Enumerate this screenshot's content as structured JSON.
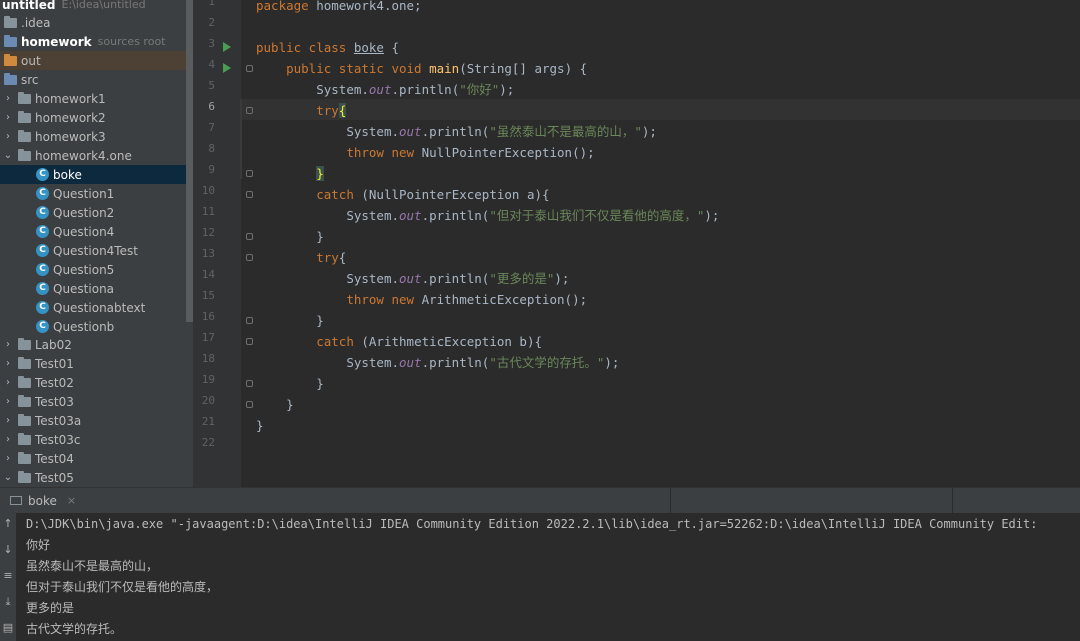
{
  "project": {
    "root": {
      "name": "untitled",
      "path": "E:\\idea\\untitled"
    },
    "items": [
      {
        "label": "idea_row",
        "text": ".idea",
        "depth": 0
      },
      {
        "label": "homework",
        "text": "homework",
        "hint": "sources root"
      },
      {
        "label": "out",
        "text": "out"
      },
      {
        "label": "src",
        "text": "src"
      },
      {
        "label": "homework1",
        "text": "homework1"
      },
      {
        "label": "homework2",
        "text": "homework2"
      },
      {
        "label": "homework3",
        "text": "homework3"
      },
      {
        "label": "homework4",
        "text": "homework4.one"
      },
      {
        "label": "boke",
        "text": "boke"
      },
      {
        "label": "q1",
        "text": "Question1"
      },
      {
        "label": "q2",
        "text": "Question2"
      },
      {
        "label": "q4",
        "text": "Question4"
      },
      {
        "label": "q4t",
        "text": "Question4Test"
      },
      {
        "label": "q5",
        "text": "Question5"
      },
      {
        "label": "qa",
        "text": "Questiona"
      },
      {
        "label": "qab",
        "text": "Questionabtext"
      },
      {
        "label": "qb",
        "text": "Questionb"
      },
      {
        "label": "lab02",
        "text": "Lab02"
      },
      {
        "label": "t01",
        "text": "Test01"
      },
      {
        "label": "t02",
        "text": "Test02"
      },
      {
        "label": "t03",
        "text": "Test03"
      },
      {
        "label": "t03a",
        "text": "Test03a"
      },
      {
        "label": "t03c",
        "text": "Test03c"
      },
      {
        "label": "t04",
        "text": "Test04"
      },
      {
        "label": "t05",
        "text": "Test05"
      }
    ]
  },
  "editor": {
    "line_numbers": [
      "1",
      "2",
      "3",
      "4",
      "5",
      "6",
      "7",
      "8",
      "9",
      "10",
      "11",
      "12",
      "13",
      "14",
      "15",
      "16",
      "17",
      "18",
      "19",
      "20",
      "21",
      "22"
    ],
    "code": {
      "l1_kw": "package",
      "l1_rest": " homework4.one;",
      "l3_kw": "public class",
      "l3_cls": "boke",
      "l3_rest": " {",
      "l4_kw": "public static void",
      "l4_fn": "main",
      "l4_rest": "(String[] args) {",
      "sys": "System.",
      "out": "out",
      "println": ".println(",
      "l5_str": "\"你好\"",
      "end": ");",
      "try": "try",
      "brace_open": "{",
      "brace_close": "}",
      "l7_str": "\"虽然泰山不是最高的山，\"",
      "throw_new": "throw new",
      "l8_rest": " NullPointerException();",
      "catch": "catch",
      "l10_rest": " (NullPointerException a){",
      "l11_str": "\"但对于泰山我们不仅是看他的高度，\"",
      "l14_str": "\"更多的是\"",
      "l15_rest": " ArithmeticException();",
      "l17_rest": " (ArithmeticException b){",
      "l18_str": "\"古代文学的存托。\""
    }
  },
  "run": {
    "tab_label": "boke",
    "tab_close": "×",
    "command": "D:\\JDK\\bin\\java.exe \"-javaagent:D:\\idea\\IntelliJ IDEA Community Edition 2022.2.1\\lib\\idea_rt.jar=52262:D:\\idea\\IntelliJ IDEA Community Edit:",
    "output": [
      "你好",
      "虽然泰山不是最高的山，",
      "但对于泰山我们不仅是看他的高度，",
      "更多的是",
      "古代文学的存托。"
    ]
  }
}
